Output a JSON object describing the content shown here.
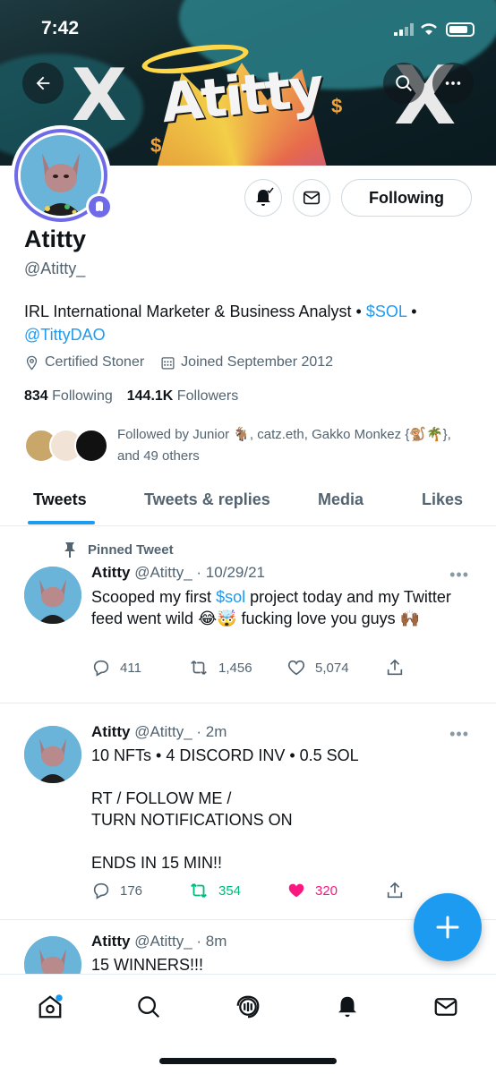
{
  "status_bar": {
    "time": "7:42"
  },
  "banner": {
    "brand_text": "Atitty"
  },
  "profile": {
    "name": "Atitty",
    "handle": "@Atitty_",
    "bio_prefix": "IRL International Marketer & Business Analyst • ",
    "bio_link1": "$SOL",
    "bio_sep": " •",
    "bio_link2": "@TittyDAO",
    "location": "Certified Stoner",
    "joined": "Joined September 2012",
    "following_count": "834",
    "following_label": "Following",
    "followers_count": "144.1K",
    "followers_label": "Followers",
    "followed_by": "Followed by Junior 🐐, catz.eth, Gakko Monkez {🐒🌴}, and 49 others",
    "follow_button_label": "Following"
  },
  "tabs": [
    {
      "label": "Tweets",
      "active": true
    },
    {
      "label": "Tweets & replies",
      "active": false
    },
    {
      "label": "Media",
      "active": false
    },
    {
      "label": "Likes",
      "active": false
    }
  ],
  "tweets": [
    {
      "pinned_label": "Pinned Tweet",
      "name": "Atitty",
      "handle": "@Atitty_",
      "time": "· 10/29/21",
      "text_pre": "Scooped my first ",
      "text_link": "$sol",
      "text_post": " project today and my Twitter feed went wild 😂🤯 fucking love you guys 🙌🏾",
      "replies": "411",
      "retweets": "1,456",
      "likes": "5,074"
    },
    {
      "name": "Atitty",
      "handle": "@Atitty_",
      "time": "· 2m",
      "text": "10 NFTs • 4 DISCORD INV • 0.5 SOL\n\nRT / FOLLOW ME /\nTURN NOTIFICATIONS ON\n\nENDS IN 15 MIN!!",
      "replies": "176",
      "retweets": "354",
      "likes": "320"
    },
    {
      "name": "Atitty",
      "handle": "@Atitty_",
      "time": "· 8m",
      "text": "15 WINNERS!!!"
    }
  ],
  "colors": {
    "accent": "#1d9bf0",
    "retweet_active": "#00ba7c",
    "like_active": "#f91880",
    "nft_badge": "#6f6ae8"
  },
  "icons": [
    "back-arrow-icon",
    "search-icon",
    "more-icon",
    "bell-icon",
    "mail-icon",
    "location-icon",
    "calendar-icon",
    "pin-icon",
    "reply-icon",
    "retweet-icon",
    "like-icon",
    "share-icon",
    "compose-icon",
    "home-icon",
    "spaces-icon"
  ]
}
